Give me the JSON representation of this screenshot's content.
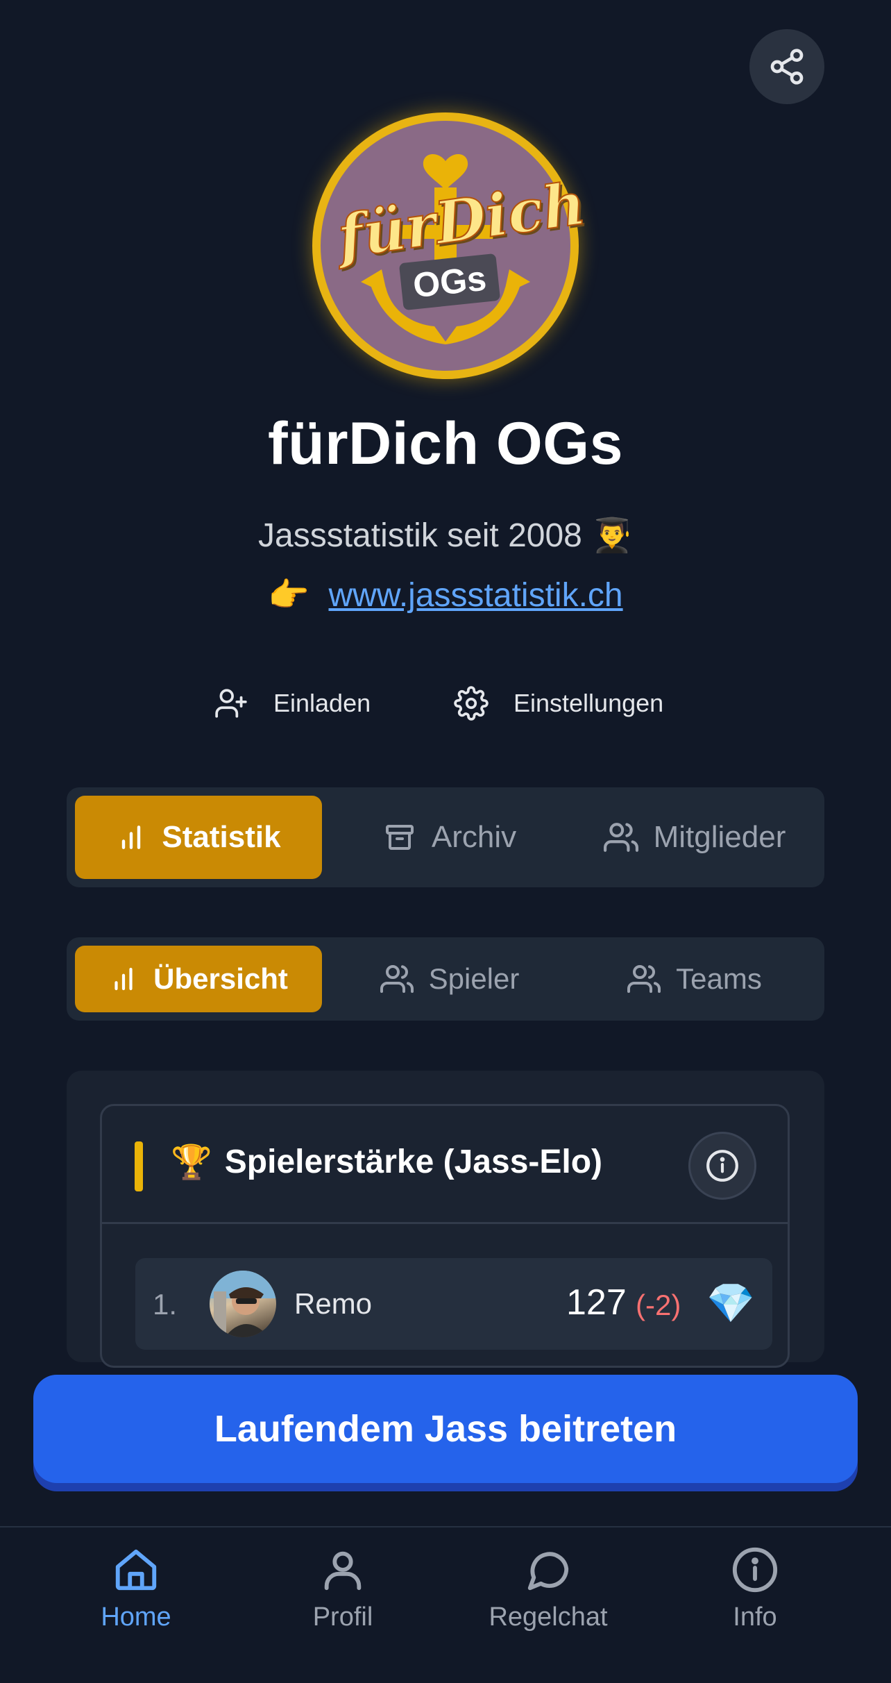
{
  "group": {
    "name": "fürDich OGs",
    "description": "Jassstatistik seit 2008 👨‍🎓",
    "link_prefix_emoji": "👉",
    "link_text": "www.jassstatistik.ch",
    "logo_text_top": "fürDich",
    "logo_text_badge": "OGs"
  },
  "actions": {
    "invite_label": "Einladen",
    "settings_label": "Einstellungen"
  },
  "main_tabs": [
    {
      "label": "Statistik",
      "icon": "bar-chart-icon",
      "active": true
    },
    {
      "label": "Archiv",
      "icon": "archive-icon",
      "active": false
    },
    {
      "label": "Mitglieder",
      "icon": "users-icon",
      "active": false
    }
  ],
  "sub_tabs": [
    {
      "label": "Übersicht",
      "icon": "bar-chart-icon",
      "active": true
    },
    {
      "label": "Spieler",
      "icon": "users-icon",
      "active": false
    },
    {
      "label": "Teams",
      "icon": "users-icon",
      "active": false
    }
  ],
  "elo_card": {
    "emoji": "🏆",
    "title": "Spielerstärke (Jass-Elo)",
    "rows": [
      {
        "rank": "1.",
        "name": "Remo",
        "elo": "127",
        "delta": "(-2)",
        "badge": "💎"
      }
    ]
  },
  "join_button_label": "Laufendem Jass beitreten",
  "bottom_nav": [
    {
      "label": "Home",
      "icon": "home-icon",
      "active": true
    },
    {
      "label": "Profil",
      "icon": "user-icon",
      "active": false
    },
    {
      "label": "Regelchat",
      "icon": "chat-icon",
      "active": false
    },
    {
      "label": "Info",
      "icon": "info-icon",
      "active": false
    }
  ],
  "colors": {
    "background": "#111827",
    "accent": "#ca8a04",
    "primary": "#2563eb",
    "link": "#60a5fa",
    "negative": "#f87171"
  }
}
